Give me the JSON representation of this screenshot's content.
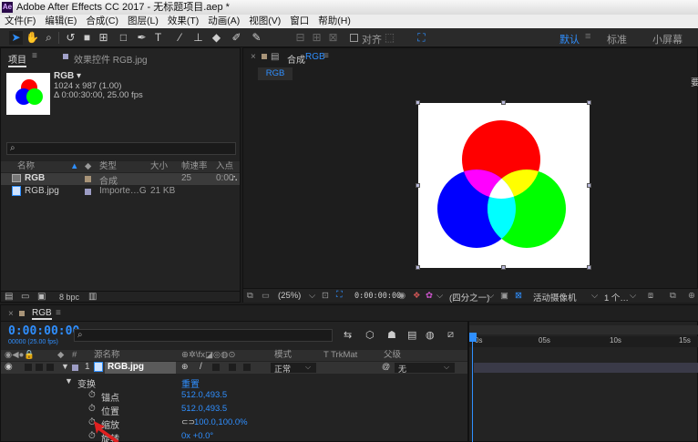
{
  "window": {
    "title": "Adobe After Effects CC 2017 - 无标题项目.aep *",
    "logo_text": "Ae"
  },
  "menu": [
    "文件(F)",
    "编辑(E)",
    "合成(C)",
    "图层(L)",
    "效果(T)",
    "动画(A)",
    "视图(V)",
    "窗口",
    "帮助(H)"
  ],
  "toolbar": {
    "snap_label": "对齐",
    "workspaces": {
      "default": "默认",
      "standard": "标准",
      "small": "小屏幕"
    }
  },
  "project_panel": {
    "tab_project": "项目",
    "tab_effects": "效果控件 RGB.jpg",
    "selected_item": {
      "name": "RGB ▾",
      "size": "1024 x 987 (1.00)",
      "duration": "Δ 0:00:30:00, 25.00 fps"
    },
    "columns": {
      "name": "名称",
      "type": "类型",
      "size": "大小",
      "fps": "帧速率",
      "in": "入点"
    },
    "items": [
      {
        "name": "RGB",
        "type": "合成",
        "size": "",
        "fps": "25",
        "in": "0:00"
      },
      {
        "name": "RGB.jpg",
        "type": "Importe…G",
        "size": "21 KB",
        "fps": "",
        "in": ""
      }
    ],
    "bpc": "8 bpc"
  },
  "comp_panel": {
    "tab": "合成",
    "tab_comp_name": "RGB",
    "breadcrumb": "RGB",
    "zoom": "(25%)",
    "timecode": "0:00:00:00",
    "resolution": "(四分之一)",
    "camera": "活动摄像机",
    "views": "1 个…",
    "right_edge_text": "要"
  },
  "timeline": {
    "tab": "RGB",
    "timecode": "0:00:00:00",
    "frame_info": "00000 (25.00 fps)",
    "header": {
      "name": "源名称",
      "mode": "模式",
      "trkmat": "T  TrkMat",
      "parent": "父级",
      "num": "#"
    },
    "layer": {
      "index": "1",
      "name": "RGB.jpg",
      "mode": "正常",
      "parent": "无"
    },
    "ruler": [
      "0s",
      "05s",
      "10s",
      "15s"
    ],
    "transform": {
      "label": "变换",
      "reset": "重置",
      "props": [
        {
          "name": "锚点",
          "value": "512.0,493.5"
        },
        {
          "name": "位置",
          "value": "512.0,493.5"
        },
        {
          "name": "缩放",
          "value": "100.0,100.0%"
        },
        {
          "name": "旋转",
          "value": "0x +0.0°"
        }
      ]
    }
  },
  "colors": {
    "accent": "#2f8fff",
    "red": "#ff0000",
    "green": "#00ff00",
    "blue": "#0000ff"
  }
}
